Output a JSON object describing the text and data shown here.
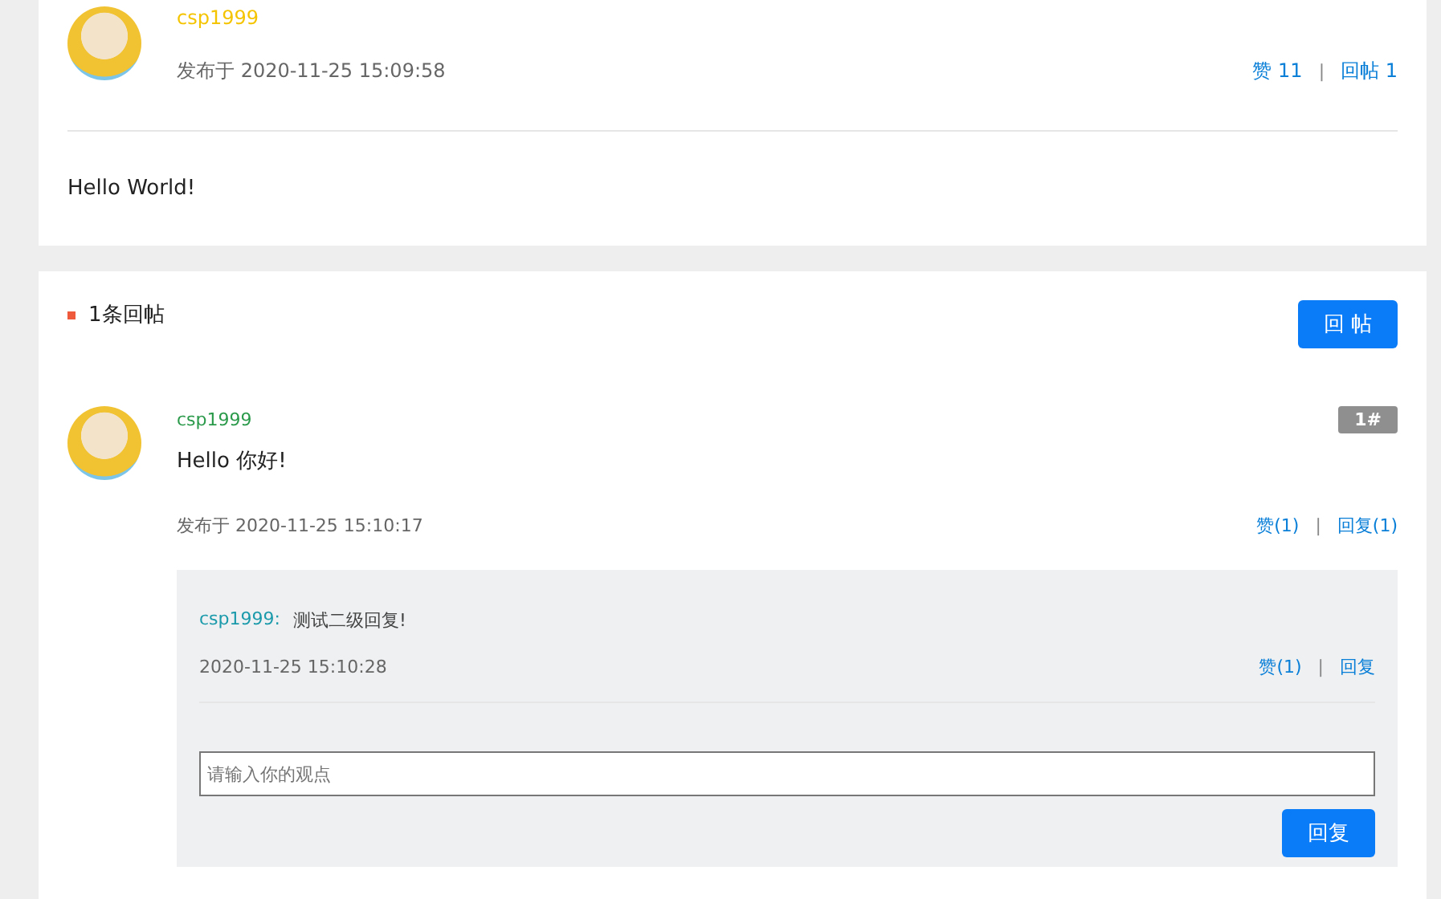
{
  "post": {
    "author": "csp1999",
    "posted": "发布于 2020-11-25 15:09:58",
    "likes": "赞 11",
    "replies": "回帖 1",
    "separator": "|",
    "body": "Hello World!"
  },
  "replies_section": {
    "title": "1条回帖",
    "reply_button": "回 帖",
    "replies": [
      {
        "author": "csp1999",
        "floor": "1#",
        "body": "Hello 你好!",
        "posted": "发布于 2020-11-25 15:10:17",
        "likes": "赞(1)",
        "separator": "|",
        "reply": "回复(1)",
        "sub_replies": [
          {
            "author": "csp1999:",
            "body": "测试二级回复!",
            "time": "2020-11-25 15:10:28",
            "likes": "赞(1)",
            "separator": "|",
            "reply": "回复"
          }
        ],
        "input": {
          "placeholder": "请输入你的观点"
        },
        "submit": "回复"
      }
    ]
  }
}
